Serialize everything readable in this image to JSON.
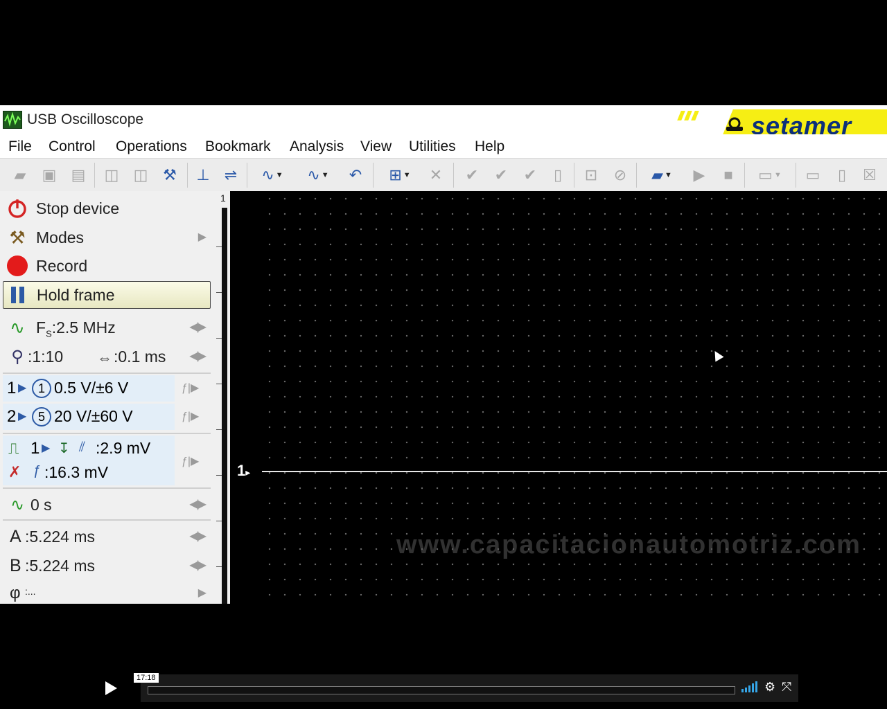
{
  "window": {
    "title": "USB Oscilloscope",
    "brand": "setamer"
  },
  "menu": [
    "File",
    "Control",
    "Operations",
    "Bookmark",
    "Analysis",
    "View",
    "Utilities",
    "Help"
  ],
  "panel": {
    "stop_device": "Stop device",
    "modes": "Modes",
    "record": "Record",
    "hold_frame": "Hold frame",
    "fs_label": "F",
    "fs_sub": "S",
    "fs_value": ":2.5 MHz",
    "zoom_value": ":1:10",
    "timebase_value": ":0.1 ms",
    "ch1_num": "1",
    "ch1_badge": "1",
    "ch1_value": "0.5 V/±6 V",
    "ch2_num": "2",
    "ch2_badge": "5",
    "ch2_value": "20 V/±60 V",
    "trig_ch": "1",
    "trig_level": ":2.9 mV",
    "trig_hyst": ":16.3 mV",
    "delay_value": "0 s",
    "cursor_a_label": "A",
    "cursor_a_value": ":5.224 ms",
    "cursor_b_label": "B",
    "cursor_b_value": ":5.224 ms",
    "phi_label": "φ",
    "phi_value": ":..."
  },
  "scale": {
    "channel_number": "1"
  },
  "scope": {
    "channel_marker": "1",
    "watermark": "www.capacitacionautomotriz.com",
    "trace_color": "#e8e8e8"
  },
  "player": {
    "timestamp": "17:18"
  },
  "colors": {
    "brand_yellow": "#f6ee14",
    "brand_blue": "#0c2f7a",
    "channel_box": "#e3eef8"
  }
}
